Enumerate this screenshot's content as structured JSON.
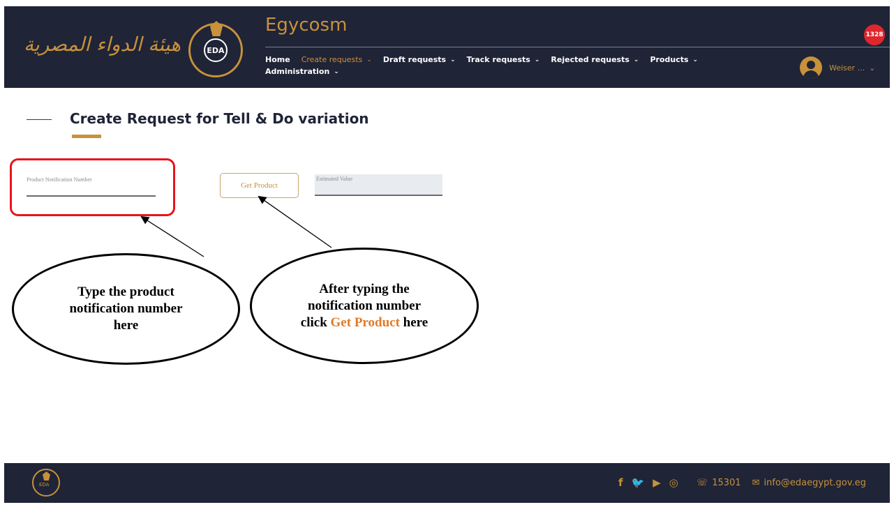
{
  "header": {
    "arabic_logo": "هيئة الدواء المصرية",
    "seal_text": "EDA",
    "app_title": "Egycosm",
    "nav": [
      {
        "label": "Home",
        "chevron": ""
      },
      {
        "label": "Create requests",
        "chevron": "⌄"
      },
      {
        "label": "Draft requests",
        "chevron": "⌄"
      },
      {
        "label": "Track requests",
        "chevron": "⌄"
      },
      {
        "label": "Rejected requests",
        "chevron": "⌄"
      },
      {
        "label": "Products",
        "chevron": "⌄"
      },
      {
        "label": "Administration",
        "chevron": "⌄"
      }
    ],
    "active_nav": "Create requests",
    "notification_count": "1328",
    "user_name": "Weiser ...",
    "user_chevron": "⌄"
  },
  "page": {
    "title": "Create Request for Tell & Do variation"
  },
  "form": {
    "product_notification_label": "Product Notification Number",
    "product_notification_value": "",
    "get_product_label": "Get Product",
    "estimated_value_label": "Estimated Value"
  },
  "callouts": {
    "first": {
      "line1": "Type the product",
      "line2": "notification number",
      "line3": "here"
    },
    "second": {
      "line1": "After typing the",
      "line2": "notification number",
      "line3_prefix": "click ",
      "line3_highlight": "Get Product",
      "line3_suffix": " here"
    }
  },
  "footer": {
    "seal_text": "EDA",
    "social_icons": [
      "facebook-icon",
      "twitter-icon",
      "youtube-icon",
      "instagram-icon"
    ],
    "phone": "15301",
    "email": "info@edaegypt.gov.eg"
  },
  "colors": {
    "navy": "#1f2437",
    "gold": "#c8913a",
    "highlight_red": "#e8141b",
    "callout_orange": "#e07b28"
  }
}
